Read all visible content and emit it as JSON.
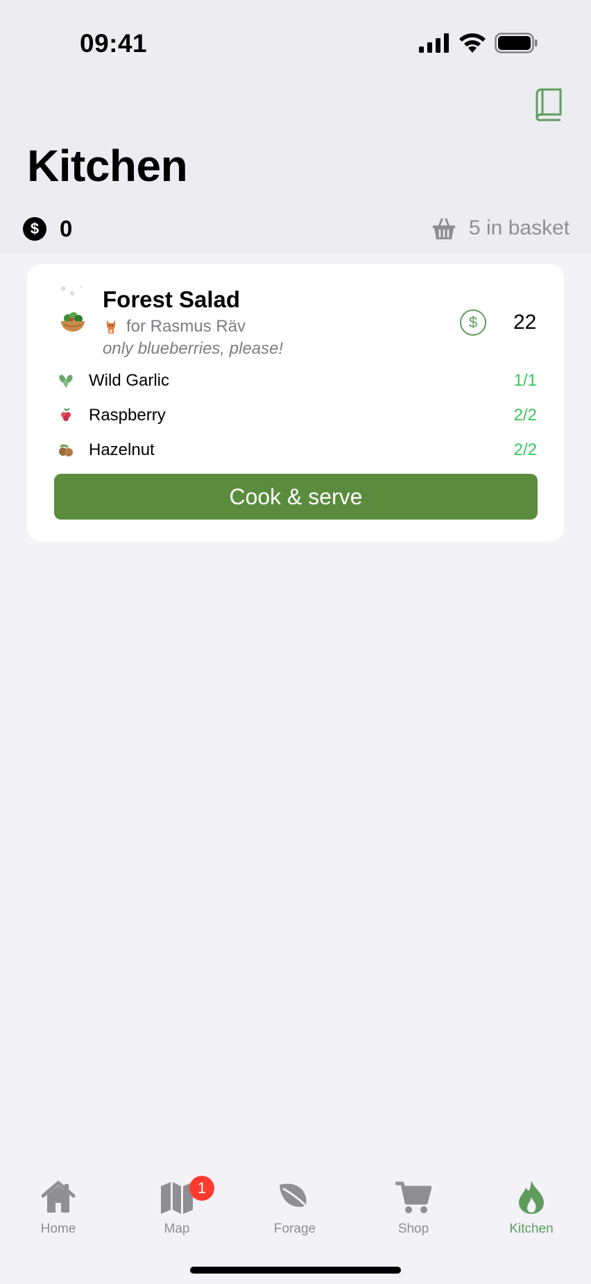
{
  "status_bar": {
    "time": "09:41"
  },
  "header": {
    "title": "Kitchen",
    "coins": {
      "icon": "dollar-coin-icon",
      "symbol": "$",
      "value": "0"
    },
    "basket": {
      "icon": "basket-icon",
      "label": "5 in basket"
    },
    "book_icon": "recipe-book-icon"
  },
  "recipe_card": {
    "title": "Forest Salad",
    "customer_line": "for Rasmus Räv",
    "note": "only blueberries, please!",
    "price": {
      "icon": "dollar-circle-icon",
      "symbol": "$",
      "value": "22"
    },
    "ingredients": [
      {
        "name": "Wild Garlic",
        "qty": "1/1",
        "icon": "wild-garlic-icon"
      },
      {
        "name": "Raspberry",
        "qty": "2/2",
        "icon": "raspberry-icon"
      },
      {
        "name": "Hazelnut",
        "qty": "2/2",
        "icon": "hazelnut-icon"
      }
    ],
    "action_label": "Cook & serve"
  },
  "tabbar": {
    "tabs": [
      {
        "label": "Home",
        "icon": "house-icon"
      },
      {
        "label": "Map",
        "icon": "map-icon",
        "badge": "1"
      },
      {
        "label": "Forage",
        "icon": "leaf-icon"
      },
      {
        "label": "Shop",
        "icon": "cart-icon"
      },
      {
        "label": "Kitchen",
        "icon": "flame-icon",
        "active": true
      }
    ]
  },
  "colors": {
    "accent_green": "#5e9c5e",
    "button_green": "#5b8c3e",
    "qty_green": "#34c759",
    "badge_red": "#ff3b30"
  }
}
